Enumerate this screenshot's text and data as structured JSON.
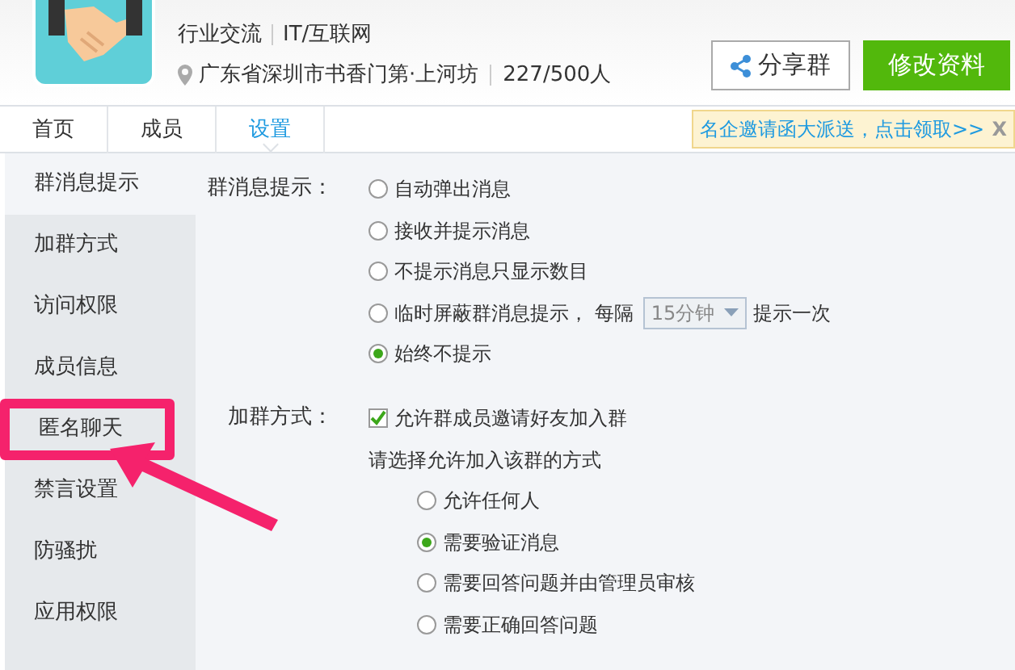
{
  "header": {
    "category": "行业交流",
    "industry": "IT/互联网",
    "location": "广东省深圳市书香门第·上河坊",
    "members": "227/500人",
    "buttons": [
      {
        "label": "分享群",
        "kind": "share"
      },
      {
        "label": "修改资料",
        "kind": "primary"
      }
    ]
  },
  "tabs": [
    {
      "label": "首页",
      "selected": false
    },
    {
      "label": "成员",
      "selected": false
    },
    {
      "label": "设置",
      "selected": true
    }
  ],
  "promo": {
    "text": "名企邀请函大派送，点击领取>>",
    "close": "X"
  },
  "sidebar": {
    "items": [
      {
        "label": "群消息提示",
        "selected": true,
        "highlighted": false
      },
      {
        "label": "加群方式",
        "selected": false,
        "highlighted": false
      },
      {
        "label": "访问权限",
        "selected": false,
        "highlighted": false
      },
      {
        "label": "成员信息",
        "selected": false,
        "highlighted": false
      },
      {
        "label": "匿名聊天",
        "selected": false,
        "highlighted": true
      },
      {
        "label": "禁言设置",
        "selected": false,
        "highlighted": false
      },
      {
        "label": "防骚扰",
        "selected": false,
        "highlighted": false
      },
      {
        "label": "应用权限",
        "selected": false,
        "highlighted": false
      }
    ]
  },
  "sections": [
    {
      "label": "群消息提示：",
      "rows": [
        {
          "kind": "radio",
          "label": "自动弹出消息",
          "selected": false,
          "indent": false
        },
        {
          "kind": "radio",
          "label": "接收并提示消息",
          "selected": false,
          "indent": false
        },
        {
          "kind": "radio",
          "label": "不提示消息只显示数目",
          "selected": false,
          "indent": false
        },
        {
          "kind": "interval",
          "label": "临时屏蔽群消息提示， 每隔",
          "selected": false,
          "value": "15分钟",
          "suffix": "提示一次",
          "indent": false
        },
        {
          "kind": "radio",
          "label": "始终不提示",
          "selected": true,
          "indent": false
        }
      ]
    },
    {
      "label": "加群方式：",
      "rows": [
        {
          "kind": "checkbox",
          "label": "允许群成员邀请好友加入群",
          "checked": true,
          "indent": false
        },
        {
          "kind": "text",
          "label": "请选择允许加入该群的方式",
          "indent": false
        },
        {
          "kind": "radio",
          "label": "允许任何人",
          "selected": false,
          "indent": true
        },
        {
          "kind": "radio",
          "label": "需要验证消息",
          "selected": true,
          "indent": true
        },
        {
          "kind": "radio",
          "label": "需要回答问题并由管理员审核",
          "selected": false,
          "indent": true
        },
        {
          "kind": "radio",
          "label": "需要正确回答问题",
          "selected": false,
          "indent": true
        }
      ]
    }
  ]
}
